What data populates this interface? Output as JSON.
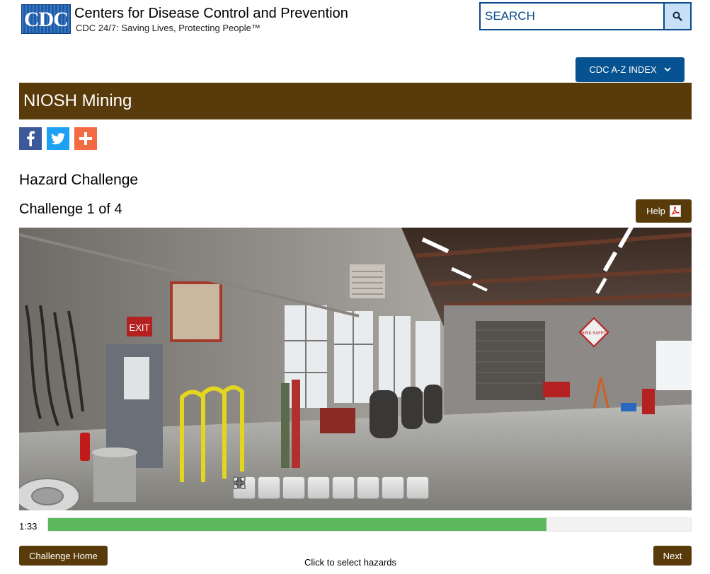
{
  "header": {
    "logo_text": "CDC",
    "org_name": "Centers for Disease Control and Prevention",
    "tagline": "CDC 24/7: Saving Lives, Protecting People™",
    "search": {
      "placeholder": "SEARCH",
      "value": ""
    },
    "az_index_label": "CDC A-Z INDEX"
  },
  "site": {
    "title": "NIOSH Mining"
  },
  "share": [
    "facebook-icon",
    "twitter-icon",
    "plus-icon"
  ],
  "page": {
    "title": "Hazard Challenge",
    "challenge_label": "Challenge 1 of 4",
    "help_label": "Help"
  },
  "panorama": {
    "signs": {
      "exit": "EXIT",
      "safety": "THINK SAFETY"
    },
    "controls": [
      "zoom-in-icon",
      "zoom-out-icon",
      "pan-left-icon",
      "pan-right-icon",
      "pan-up-icon",
      "pan-down-icon",
      "move-icon",
      "fullscreen-icon"
    ]
  },
  "timer": {
    "time": "1:33",
    "progress_fraction": 0.775,
    "progress_color": "#5cb85c"
  },
  "footer": {
    "home_label": "Challenge Home",
    "instruction": "Click to select hazards",
    "next_label": "Next"
  },
  "colors": {
    "brand_brown": "#593b0b",
    "cdc_blue": "#075290",
    "search_border": "#0b4a8b"
  }
}
